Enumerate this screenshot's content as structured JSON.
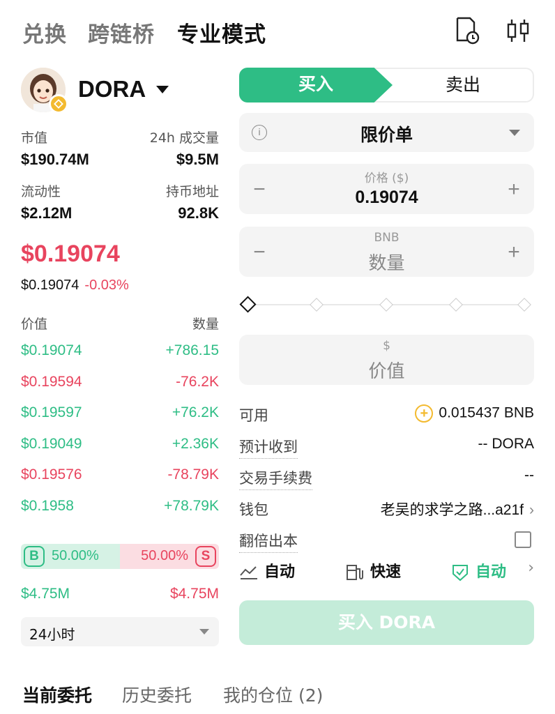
{
  "top_tabs": {
    "swap": "兑换",
    "bridge": "跨链桥",
    "pro": "专业模式"
  },
  "token": {
    "symbol": "DORA"
  },
  "stats": {
    "market_cap_label": "市值",
    "market_cap": "$190.74M",
    "volume_label": "24h 成交量",
    "volume": "$9.5M",
    "liquidity_label": "流动性",
    "liquidity": "$2.12M",
    "holders_label": "持币地址",
    "holders": "92.8K"
  },
  "price": {
    "big": "$0.19074",
    "sub": "$0.19074",
    "change": "-0.03%"
  },
  "orderbook": {
    "price_header": "价值",
    "qty_header": "数量",
    "rows": [
      {
        "price": "$0.19074",
        "qty": "+786.15",
        "side": "buy"
      },
      {
        "price": "$0.19594",
        "qty": "-76.2K",
        "side": "sell"
      },
      {
        "price": "$0.19597",
        "qty": "+76.2K",
        "side": "buy"
      },
      {
        "price": "$0.19049",
        "qty": "+2.36K",
        "side": "buy"
      },
      {
        "price": "$0.19576",
        "qty": "-78.79K",
        "side": "sell"
      },
      {
        "price": "$0.1958",
        "qty": "+78.79K",
        "side": "buy"
      }
    ]
  },
  "ratio": {
    "buy_label": "B",
    "buy_pct": "50.00%",
    "sell_label": "S",
    "sell_pct": "50.00%",
    "buy_vol": "$4.75M",
    "sell_vol": "$4.75M"
  },
  "period": {
    "selected": "24小时"
  },
  "trade": {
    "buy_tab": "买入",
    "sell_tab": "卖出",
    "order_type": "限价单",
    "price_label": "价格 ($)",
    "price_value": "0.19074",
    "qty_unit": "BNB",
    "qty_placeholder": "数量",
    "value_unit": "$",
    "value_placeholder": "价值",
    "slider_level": 0
  },
  "info": {
    "available_label": "可用",
    "available_value": "0.015437 BNB",
    "expected_label": "预计收到",
    "expected_value": "-- DORA",
    "fee_label": "交易手续费",
    "fee_value": "--",
    "wallet_label": "钱包",
    "wallet_value": "老吴的求学之路...a21f",
    "double_label": "翻倍出本"
  },
  "options": {
    "slippage": "自动",
    "speed": "快速",
    "mev": "自动"
  },
  "buy_button": "买入 DORA",
  "bottom_tabs": {
    "current": "当前委托",
    "history": "历史委托",
    "positions": "我的仓位 (2)"
  },
  "colors": {
    "accent": "#2ebd85",
    "down": "#e8445e",
    "coin": "#f3ba2f"
  }
}
